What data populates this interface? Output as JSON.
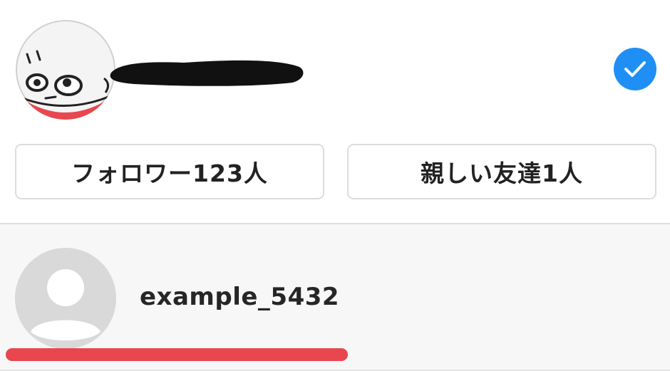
{
  "profile": {
    "name_redacted": true,
    "verified_check": "check-icon",
    "accent_color": "#1f8ff5"
  },
  "buttons": {
    "followers_label": "フォロワー123人",
    "close_friends_label": "親しい友達1人"
  },
  "list": {
    "items": [
      {
        "username": "example_5432",
        "avatar": "default-avatar-icon"
      }
    ],
    "highlight_color": "#e8474f"
  }
}
